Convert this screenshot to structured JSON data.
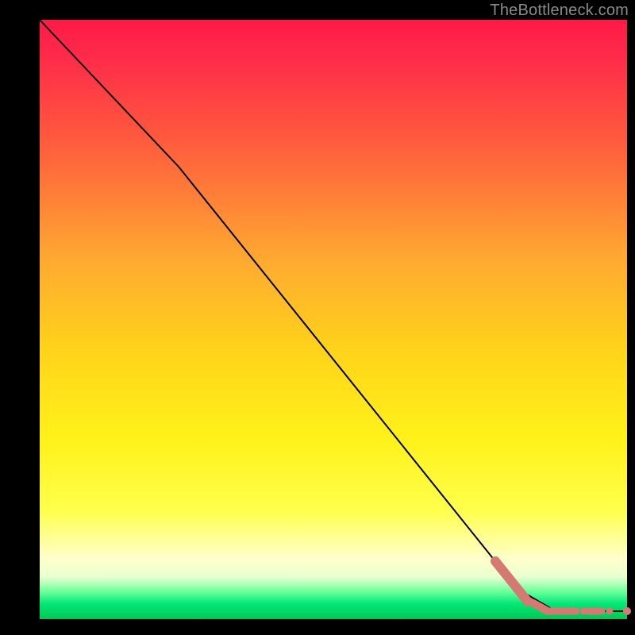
{
  "attribution": "TheBottleneck.com",
  "chart_data": {
    "type": "line",
    "title": "",
    "xlabel": "",
    "ylabel": "",
    "xlim": [
      50,
      790
    ],
    "ylim": [
      25,
      780
    ],
    "gradient_stops": [
      {
        "offset": 0.0,
        "color": "#ff1a47"
      },
      {
        "offset": 0.06,
        "color": "#ff2a4a"
      },
      {
        "offset": 0.2,
        "color": "#ff5a3d"
      },
      {
        "offset": 0.4,
        "color": "#ffa931"
      },
      {
        "offset": 0.55,
        "color": "#ffd31a"
      },
      {
        "offset": 0.7,
        "color": "#fff21a"
      },
      {
        "offset": 0.82,
        "color": "#ffff4d"
      },
      {
        "offset": 0.9,
        "color": "#ffffcc"
      },
      {
        "offset": 0.93,
        "color": "#e8ffd0"
      },
      {
        "offset": 0.955,
        "color": "#66ff99"
      },
      {
        "offset": 0.975,
        "color": "#00e676"
      },
      {
        "offset": 1.0,
        "color": "#00c853"
      }
    ],
    "black_line": [
      {
        "x": 50,
        "y": 25
      },
      {
        "x": 225,
        "y": 210
      },
      {
        "x": 652,
        "y": 742
      },
      {
        "x": 700,
        "y": 770
      },
      {
        "x": 790,
        "y": 770
      }
    ],
    "marker_segments": [
      {
        "x1": 624,
        "y1": 707,
        "x2": 665,
        "y2": 758,
        "w": 12
      },
      {
        "x1": 672,
        "y1": 760,
        "x2": 690,
        "y2": 770,
        "w": 10
      },
      {
        "x1": 700,
        "y1": 770,
        "x2": 726,
        "y2": 770,
        "w": 9
      },
      {
        "x1": 740,
        "y1": 770,
        "x2": 758,
        "y2": 770,
        "w": 9
      }
    ],
    "marker_dots": [
      {
        "x": 668,
        "y": 758,
        "r": 5
      },
      {
        "x": 695,
        "y": 770,
        "r": 5
      },
      {
        "x": 735,
        "y": 770,
        "r": 4.5
      },
      {
        "x": 768,
        "y": 770,
        "r": 4.5
      },
      {
        "x": 790,
        "y": 770,
        "r": 5
      }
    ],
    "marker_color": "#d57a72"
  }
}
